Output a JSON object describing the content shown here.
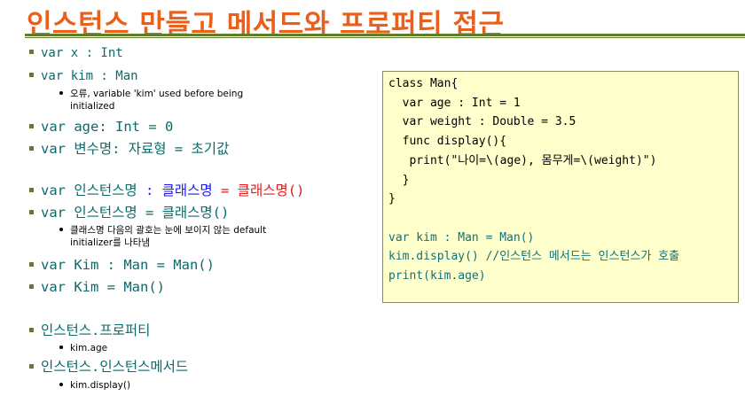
{
  "title": "인스턴스 만들고 메서드와 프로퍼티 접근",
  "bullets": {
    "b1": "var x : Int",
    "b2": "var kim : Man",
    "b2_sub_line1": "오류, variable 'kim' used before being",
    "b2_sub_line2": "initialized",
    "b3": "var age: Int = 0",
    "b4": "var 변수명: 자료형 = 초기값",
    "b5_part1": "var 인스턴스명 ",
    "b5_part2": ": 클래스명",
    "b5_part3": " = 클래스명()",
    "b6": "var 인스턴스명 = 클래스명()",
    "b6_sub_line1": "클래스명 다음의 괄호는 눈에 보이지 않는 default",
    "b6_sub_line2": "initializer를 나타냄",
    "b7": "var Kim : Man = Man()",
    "b8": "var Kim = Man()",
    "b9": "인스턴스.프로퍼티",
    "b9_sub": "kim.age",
    "b10": "인스턴스.인스턴스메서드",
    "b10_sub": "kim.display()"
  },
  "code": {
    "lines": [
      "class Man{",
      "  var age : Int = 1",
      "  var weight : Double = 3.5",
      "  func display(){",
      "   print(\"나이=\\(age), 몸무게=\\(weight)\")",
      "  }",
      "}"
    ],
    "usage": [
      "var kim : Man = Man()",
      "kim.display() //인스턴스 메서드는 인스턴스가 호출",
      "print(kim.age)"
    ]
  },
  "colors": {
    "title": "#e8601c",
    "rule": "#5e7d2b",
    "text_teal": "#0a6a6a",
    "class_blue": "#1a1ae6",
    "init_red": "#e01a1a",
    "code_bg": "#ffffcc"
  }
}
